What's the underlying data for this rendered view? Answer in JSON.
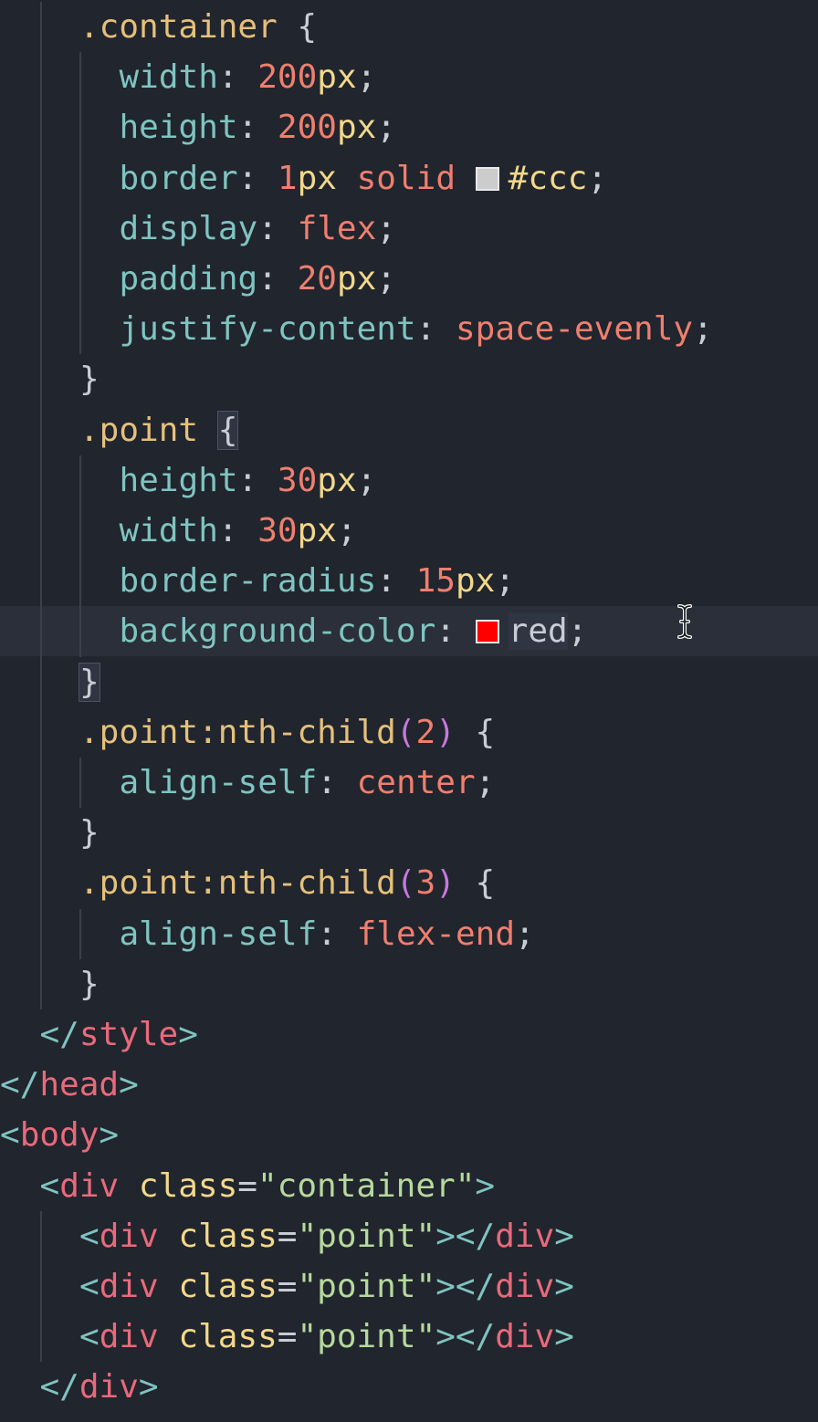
{
  "editor": {
    "language": "html",
    "active_line_index": 12,
    "lines": [
      {
        "indent": 2,
        "parts": [
          {
            "t": ".container",
            "c": "sel"
          },
          {
            "t": " {",
            "c": "pun"
          }
        ]
      },
      {
        "indent": 3,
        "parts": [
          {
            "t": "width",
            "c": "prop"
          },
          {
            "t": ": ",
            "c": "pun"
          },
          {
            "t": "200",
            "c": "num"
          },
          {
            "t": "px",
            "c": "unit"
          },
          {
            "t": ";",
            "c": "pun"
          }
        ]
      },
      {
        "indent": 3,
        "parts": [
          {
            "t": "height",
            "c": "prop"
          },
          {
            "t": ": ",
            "c": "pun"
          },
          {
            "t": "200",
            "c": "num"
          },
          {
            "t": "px",
            "c": "unit"
          },
          {
            "t": ";",
            "c": "pun"
          }
        ]
      },
      {
        "indent": 3,
        "parts": [
          {
            "t": "border",
            "c": "prop"
          },
          {
            "t": ": ",
            "c": "pun"
          },
          {
            "t": "1",
            "c": "num"
          },
          {
            "t": "px",
            "c": "unit"
          },
          {
            "t": " solid ",
            "c": "kw"
          },
          {
            "swatch": "#cccccc"
          },
          {
            "t": "#ccc",
            "c": "hexv"
          },
          {
            "t": ";",
            "c": "pun"
          }
        ]
      },
      {
        "indent": 3,
        "parts": [
          {
            "t": "display",
            "c": "prop"
          },
          {
            "t": ": ",
            "c": "pun"
          },
          {
            "t": "flex",
            "c": "kw"
          },
          {
            "t": ";",
            "c": "pun"
          }
        ]
      },
      {
        "indent": 3,
        "parts": [
          {
            "t": "padding",
            "c": "prop"
          },
          {
            "t": ": ",
            "c": "pun"
          },
          {
            "t": "20",
            "c": "num"
          },
          {
            "t": "px",
            "c": "unit"
          },
          {
            "t": ";",
            "c": "pun"
          }
        ]
      },
      {
        "indent": 3,
        "parts": [
          {
            "t": "justify-content",
            "c": "prop"
          },
          {
            "t": ": ",
            "c": "pun"
          },
          {
            "t": "space-evenly",
            "c": "kw"
          },
          {
            "t": ";",
            "c": "pun"
          }
        ]
      },
      {
        "indent": 2,
        "parts": [
          {
            "t": "}",
            "c": "pun"
          }
        ]
      },
      {
        "indent": 2,
        "parts": [
          {
            "t": ".point",
            "c": "sel"
          },
          {
            "t": " ",
            "c": "pun"
          },
          {
            "t": "{",
            "c": "pun",
            "hl": "brace"
          }
        ]
      },
      {
        "indent": 3,
        "parts": [
          {
            "t": "height",
            "c": "prop"
          },
          {
            "t": ": ",
            "c": "pun"
          },
          {
            "t": "30",
            "c": "num"
          },
          {
            "t": "px",
            "c": "unit"
          },
          {
            "t": ";",
            "c": "pun"
          }
        ]
      },
      {
        "indent": 3,
        "parts": [
          {
            "t": "width",
            "c": "prop"
          },
          {
            "t": ": ",
            "c": "pun"
          },
          {
            "t": "30",
            "c": "num"
          },
          {
            "t": "px",
            "c": "unit"
          },
          {
            "t": ";",
            "c": "pun"
          }
        ]
      },
      {
        "indent": 3,
        "parts": [
          {
            "t": "border-radius",
            "c": "prop"
          },
          {
            "t": ": ",
            "c": "pun"
          },
          {
            "t": "15",
            "c": "num"
          },
          {
            "t": "px",
            "c": "unit"
          },
          {
            "t": ";",
            "c": "pun"
          }
        ]
      },
      {
        "indent": 3,
        "parts": [
          {
            "t": "background-color",
            "c": "prop"
          },
          {
            "t": ": ",
            "c": "pun"
          },
          {
            "swatch": "#ff0000"
          },
          {
            "t": "red",
            "c": "pun",
            "hl": "word"
          },
          {
            "t": ";",
            "c": "pun"
          }
        ]
      },
      {
        "indent": 2,
        "parts": [
          {
            "t": "}",
            "c": "pun",
            "hl": "brace"
          }
        ]
      },
      {
        "indent": 2,
        "parts": [
          {
            "t": ".point:nth-child",
            "c": "sel"
          },
          {
            "t": "(",
            "c": "paren"
          },
          {
            "t": "2",
            "c": "num"
          },
          {
            "t": ")",
            "c": "paren"
          },
          {
            "t": " {",
            "c": "pun"
          }
        ]
      },
      {
        "indent": 3,
        "parts": [
          {
            "t": "align-self",
            "c": "prop"
          },
          {
            "t": ": ",
            "c": "pun"
          },
          {
            "t": "center",
            "c": "kw"
          },
          {
            "t": ";",
            "c": "pun"
          }
        ]
      },
      {
        "indent": 2,
        "parts": [
          {
            "t": "}",
            "c": "pun"
          }
        ]
      },
      {
        "indent": 2,
        "parts": [
          {
            "t": ".point:nth-child",
            "c": "sel"
          },
          {
            "t": "(",
            "c": "paren"
          },
          {
            "t": "3",
            "c": "num"
          },
          {
            "t": ")",
            "c": "paren"
          },
          {
            "t": " {",
            "c": "pun"
          }
        ]
      },
      {
        "indent": 3,
        "parts": [
          {
            "t": "align-self",
            "c": "prop"
          },
          {
            "t": ": ",
            "c": "pun"
          },
          {
            "t": "flex-end",
            "c": "kw"
          },
          {
            "t": ";",
            "c": "pun"
          }
        ]
      },
      {
        "indent": 2,
        "parts": [
          {
            "t": "}",
            "c": "pun"
          }
        ]
      },
      {
        "indent": 1,
        "parts": [
          {
            "t": "</",
            "c": "tagb"
          },
          {
            "t": "style",
            "c": "tag"
          },
          {
            "t": ">",
            "c": "tagb"
          }
        ]
      },
      {
        "indent": 0,
        "parts": [
          {
            "t": "</",
            "c": "tagb"
          },
          {
            "t": "head",
            "c": "tag"
          },
          {
            "t": ">",
            "c": "tagb"
          }
        ]
      },
      {
        "indent": 0,
        "parts": [
          {
            "t": "<",
            "c": "tagb"
          },
          {
            "t": "body",
            "c": "tag"
          },
          {
            "t": ">",
            "c": "tagb"
          }
        ]
      },
      {
        "indent": 1,
        "parts": [
          {
            "t": "<",
            "c": "tagb"
          },
          {
            "t": "div",
            "c": "tag"
          },
          {
            "t": " ",
            "c": "pun"
          },
          {
            "t": "class",
            "c": "attr"
          },
          {
            "t": "=",
            "c": "pun"
          },
          {
            "t": "\"container\"",
            "c": "str"
          },
          {
            "t": ">",
            "c": "tagb"
          }
        ]
      },
      {
        "indent": 2,
        "parts": [
          {
            "t": "<",
            "c": "tagb"
          },
          {
            "t": "div",
            "c": "tag"
          },
          {
            "t": " ",
            "c": "pun"
          },
          {
            "t": "class",
            "c": "attr"
          },
          {
            "t": "=",
            "c": "pun"
          },
          {
            "t": "\"point\"",
            "c": "str"
          },
          {
            "t": "></",
            "c": "tagb"
          },
          {
            "t": "div",
            "c": "tag"
          },
          {
            "t": ">",
            "c": "tagb"
          }
        ]
      },
      {
        "indent": 2,
        "parts": [
          {
            "t": "<",
            "c": "tagb"
          },
          {
            "t": "div",
            "c": "tag"
          },
          {
            "t": " ",
            "c": "pun"
          },
          {
            "t": "class",
            "c": "attr"
          },
          {
            "t": "=",
            "c": "pun"
          },
          {
            "t": "\"point\"",
            "c": "str"
          },
          {
            "t": "></",
            "c": "tagb"
          },
          {
            "t": "div",
            "c": "tag"
          },
          {
            "t": ">",
            "c": "tagb"
          }
        ]
      },
      {
        "indent": 2,
        "parts": [
          {
            "t": "<",
            "c": "tagb"
          },
          {
            "t": "div",
            "c": "tag"
          },
          {
            "t": " ",
            "c": "pun"
          },
          {
            "t": "class",
            "c": "attr"
          },
          {
            "t": "=",
            "c": "pun"
          },
          {
            "t": "\"point\"",
            "c": "str"
          },
          {
            "t": "></",
            "c": "tagb"
          },
          {
            "t": "div",
            "c": "tag"
          },
          {
            "t": ">",
            "c": "tagb"
          }
        ]
      },
      {
        "indent": 1,
        "parts": [
          {
            "t": "</",
            "c": "tagb"
          },
          {
            "t": "div",
            "c": "tag"
          },
          {
            "t": ">",
            "c": "tagb"
          }
        ]
      }
    ]
  },
  "colors": {
    "background": "#21252e",
    "selector": "#e5c07b",
    "property": "#7fc4c0",
    "number": "#ef7f6e",
    "unit": "#f2d88a",
    "tag": "#e86a7b",
    "string": "#b5d99c"
  },
  "cursor": {
    "icon": "i-beam-cursor-icon"
  }
}
